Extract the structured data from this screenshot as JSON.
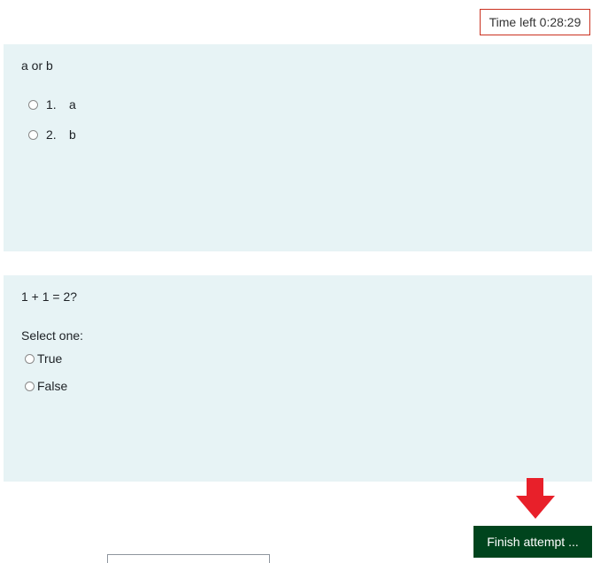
{
  "timer": {
    "label": "Time left 0:28:29"
  },
  "questions": [
    {
      "text": "a or b",
      "options": [
        {
          "number": "1.",
          "label": "a"
        },
        {
          "number": "2.",
          "label": "b"
        }
      ]
    },
    {
      "text": "1 + 1 = 2?",
      "prompt": "Select one:",
      "options": [
        {
          "label": "True"
        },
        {
          "label": "False"
        }
      ]
    }
  ],
  "actions": {
    "finish_label": "Finish attempt ..."
  },
  "colors": {
    "panel_bg": "#e7f3f5",
    "timer_border": "#ca3120",
    "finish_bg": "#00441d",
    "arrow": "#e8202a"
  }
}
